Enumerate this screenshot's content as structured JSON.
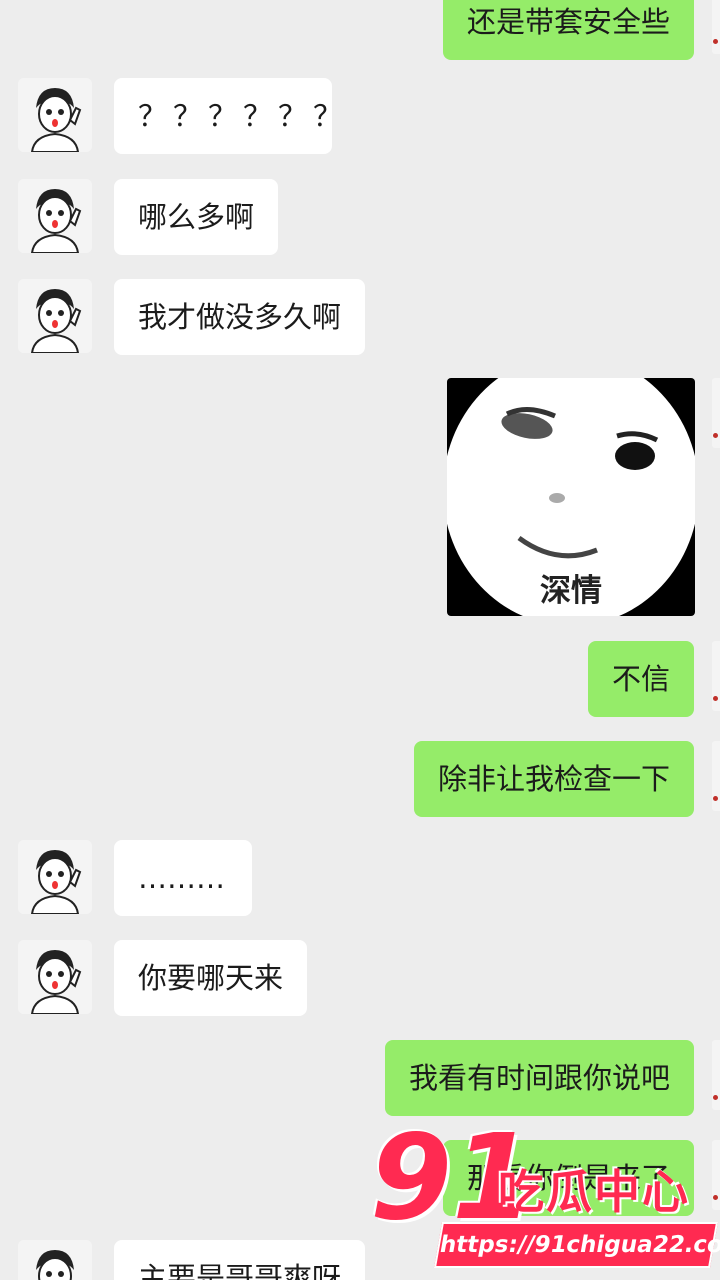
{
  "colors": {
    "background": "#ededed",
    "sent_bubble": "#95ec69",
    "received_bubble": "#ffffff",
    "watermark": "#ff2a51"
  },
  "messages": [
    {
      "side": "right",
      "text": "还是带套安全些"
    },
    {
      "side": "left",
      "text": "？？？？？？"
    },
    {
      "side": "left",
      "text": "哪么多啊"
    },
    {
      "side": "left",
      "text": "我才做没多久啊"
    },
    {
      "side": "right",
      "type": "sticker",
      "caption": "深情"
    },
    {
      "side": "right",
      "text": "不信"
    },
    {
      "side": "right",
      "text": "除非让我检查一下"
    },
    {
      "side": "left",
      "text": "………"
    },
    {
      "side": "left",
      "text": "你要哪天来"
    },
    {
      "side": "right",
      "text": "我看有时间跟你说吧"
    },
    {
      "side": "right",
      "text": "那看你倒是来了"
    },
    {
      "side": "left",
      "text": "主要是哥哥爽呀"
    }
  ],
  "watermark": {
    "number": "91",
    "name": "吃瓜中心",
    "url": "https://91chigua22.com"
  }
}
